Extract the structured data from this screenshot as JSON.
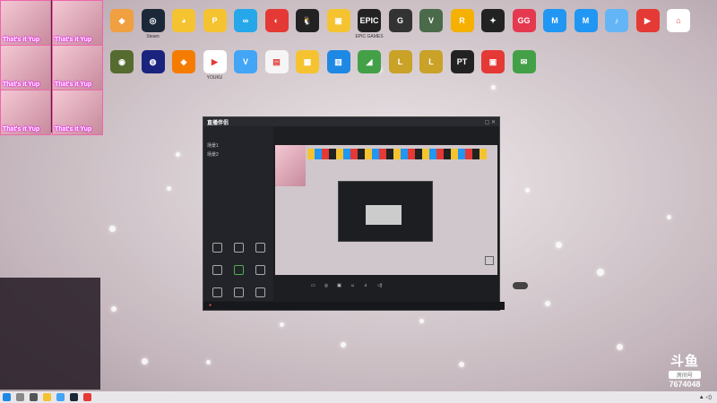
{
  "desktop_icons_row1": [
    {
      "label": "",
      "color": "#f0a040",
      "glyph": "◆"
    },
    {
      "label": "Steam",
      "color": "#1b2838",
      "glyph": "◎"
    },
    {
      "label": "",
      "color": "#f5c330",
      "glyph": "◕"
    },
    {
      "label": "",
      "color": "#f5c330",
      "glyph": "P"
    },
    {
      "label": "",
      "color": "#25a7ea",
      "glyph": "∞"
    },
    {
      "label": "",
      "color": "#e53935",
      "glyph": "◐"
    },
    {
      "label": "",
      "color": "#222",
      "glyph": "🐧"
    },
    {
      "label": "",
      "color": "#f5c330",
      "glyph": "▣"
    },
    {
      "label": "EPIC GAMES",
      "color": "#222",
      "glyph": "EPIC"
    },
    {
      "label": "",
      "color": "#333",
      "glyph": "G"
    },
    {
      "label": "",
      "color": "#4a6a4a",
      "glyph": "V"
    },
    {
      "label": "",
      "color": "#f5b000",
      "glyph": "R"
    },
    {
      "label": "",
      "color": "#222",
      "glyph": "✦"
    },
    {
      "label": "",
      "color": "#e53950",
      "glyph": "GG"
    },
    {
      "label": "",
      "color": "#2196f3",
      "glyph": "M"
    },
    {
      "label": "",
      "color": "#2196f3",
      "glyph": "M"
    },
    {
      "label": "",
      "color": "#64b5f6",
      "glyph": "♪"
    },
    {
      "label": "",
      "color": "#e53935",
      "glyph": "▶"
    },
    {
      "label": "",
      "color": "#fff",
      "glyph": "⌂"
    }
  ],
  "desktop_icons_row2": [
    {
      "label": "",
      "color": "#556b2f",
      "glyph": "◉"
    },
    {
      "label": "",
      "color": "#1a237e",
      "glyph": "◍"
    },
    {
      "label": "",
      "color": "#f57c00",
      "glyph": "◈"
    },
    {
      "label": "YOUKU",
      "color": "#fff",
      "glyph": "▶"
    },
    {
      "label": "",
      "color": "#42a5f5",
      "glyph": "V"
    },
    {
      "label": "",
      "color": "#f5f5f5",
      "glyph": "▤"
    },
    {
      "label": "",
      "color": "#f5c330",
      "glyph": "▦"
    },
    {
      "label": "",
      "color": "#1e88e5",
      "glyph": "▥"
    },
    {
      "label": "",
      "color": "#43a047",
      "glyph": "◢"
    },
    {
      "label": "",
      "color": "#c9a227",
      "glyph": "L"
    },
    {
      "label": "",
      "color": "#c9a227",
      "glyph": "L"
    },
    {
      "label": "",
      "color": "#222",
      "glyph": "PT"
    },
    {
      "label": "",
      "color": "#e53935",
      "glyph": "▣"
    },
    {
      "label": "",
      "color": "#43a047",
      "glyph": "✉"
    }
  ],
  "cam_tiles": [
    "That's it Yup",
    "That's it Yup",
    "That's it Yup",
    "That's it Yup",
    "That's it Yup",
    "That's it Yup"
  ],
  "app": {
    "title": "直播伴侣",
    "side_labels": [
      "场景1",
      "场景2"
    ],
    "buttons": [
      "",
      "",
      "",
      "",
      "",
      "",
      "",
      "",
      ""
    ]
  },
  "chat_lines": [
    "",
    "",
    "",
    ""
  ],
  "badge": {
    "brand": "斗鱼",
    "room_label": "房间号",
    "room_number": "7674048"
  }
}
